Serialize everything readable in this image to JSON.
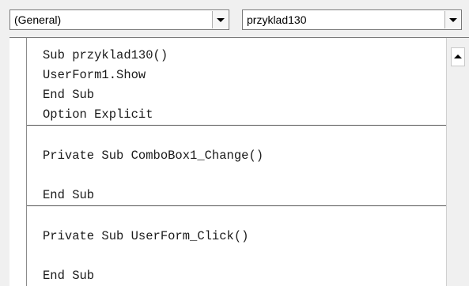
{
  "toolbar": {
    "object_combo": {
      "selected": "(General)"
    },
    "procedure_combo": {
      "selected": "przyklad130"
    }
  },
  "code": {
    "lines": [
      "Sub przyklad130()",
      "UserForm1.Show",
      "End Sub",
      "Option Explicit",
      "Private Sub ComboBox1_Change()",
      "End Sub",
      "Private Sub UserForm_Click()",
      "End Sub"
    ]
  }
}
